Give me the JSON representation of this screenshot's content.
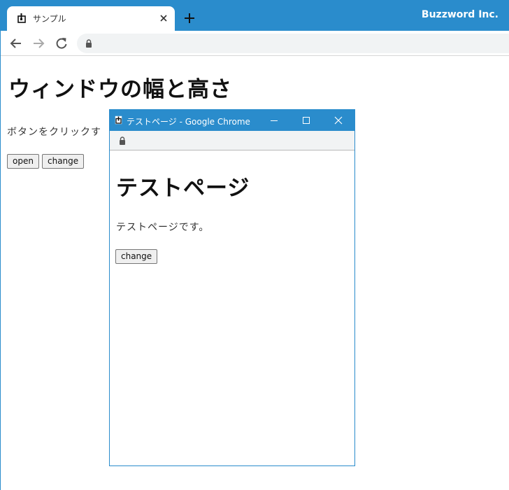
{
  "browser": {
    "tab_title": "サンプル",
    "brand": "Buzzword Inc."
  },
  "page": {
    "title": "ウィンドウの幅と高さ",
    "description": "ボタンをクリックす",
    "buttons": {
      "open": "open",
      "change": "change"
    }
  },
  "popup": {
    "window_title": "テストページ - Google Chrome",
    "heading": "テストページ",
    "text": "テストページです。",
    "button_change": "change"
  },
  "colors": {
    "chrome_blue": "#2a8ccc",
    "omnibox_bg": "#f1f3f4"
  }
}
